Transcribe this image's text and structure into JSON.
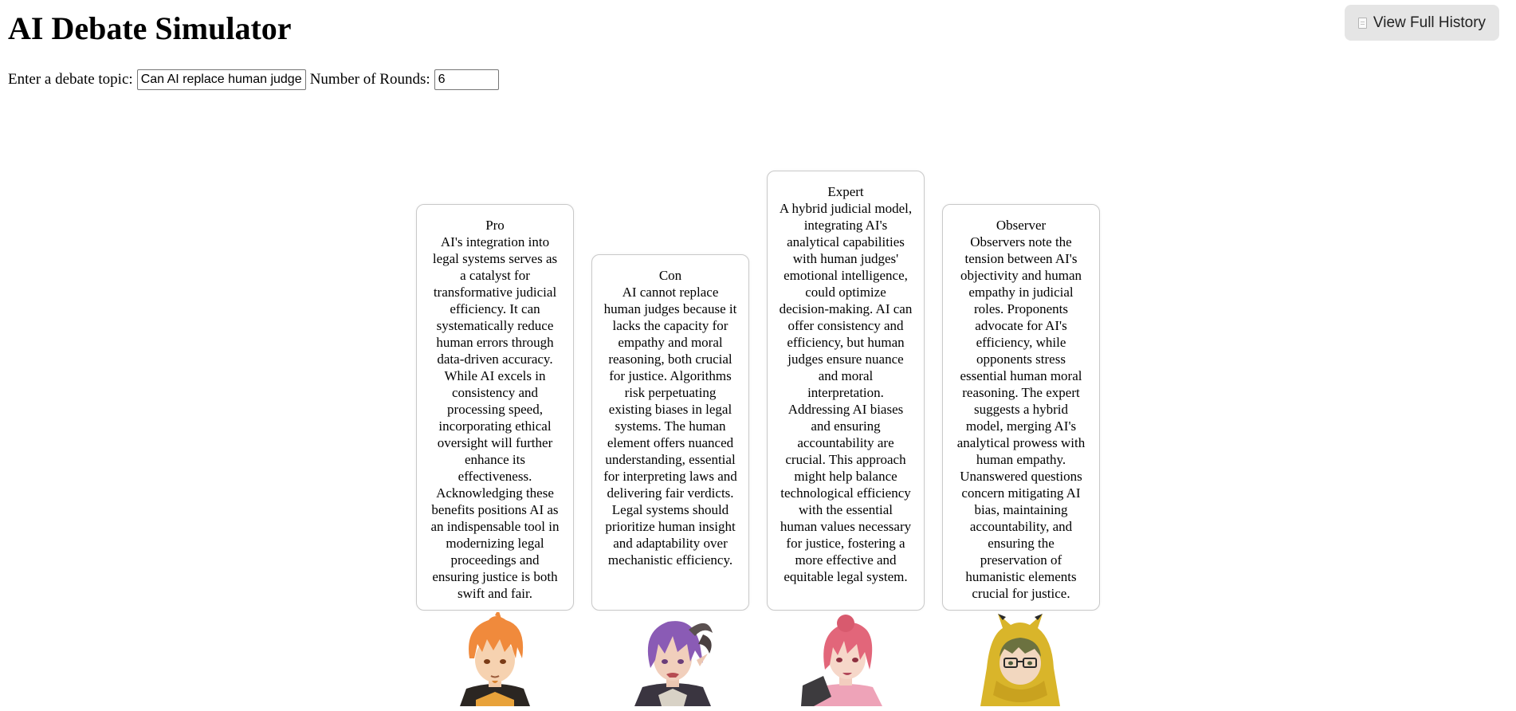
{
  "app": {
    "title": "AI Debate Simulator",
    "history_button_label": "View Full History",
    "history_icon": "document-icon"
  },
  "controls": {
    "topic_label": "Enter a debate topic:",
    "topic_value": "Can AI replace human judges?",
    "rounds_label": "Number of Rounds:",
    "rounds_value": "6"
  },
  "participants": [
    {
      "role": "Pro",
      "avatar": "orange-haired-boy-avatar",
      "text": "AI's integration into legal systems serves as a catalyst for transformative judicial efficiency. It can systematically reduce human errors through data-driven accuracy. While AI excels in consistency and processing speed, incorporating ethical oversight will further enhance its effectiveness. Acknowledging these benefits positions AI as an indispensable tool in modernizing legal proceedings and ensuring justice is both swift and fair."
    },
    {
      "role": "Con",
      "avatar": "purple-haired-horned-avatar",
      "text": "AI cannot replace human judges because it lacks the capacity for empathy and moral reasoning, both crucial for justice. Algorithms risk perpetuating existing biases in legal systems. The human element offers nuanced understanding, essential for interpreting laws and delivering fair verdicts. Legal systems should prioritize human insight and adaptability over mechanistic efficiency."
    },
    {
      "role": "Expert",
      "avatar": "pink-haired-girl-avatar",
      "text": "A hybrid judicial model, integrating AI's analytical capabilities with human judges' emotional intelligence, could optimize decision-making. AI can offer consistency and efficiency, but human judges ensure nuance and moral interpretation. Addressing AI biases and ensuring accountability are crucial. This approach might help balance technological efficiency with the essential human values necessary for justice, fostering a more effective and equitable legal system."
    },
    {
      "role": "Observer",
      "avatar": "yellow-hood-glasses-avatar",
      "text": "Observers note the tension between AI's objectivity and human empathy in judicial roles. Proponents advocate for AI's efficiency, while opponents stress essential human moral reasoning. The expert suggests a hybrid model, merging AI's analytical prowess with human empathy. Unanswered questions concern mitigating AI bias, maintaining accountability, and ensuring the preservation of humanistic elements crucial for justice."
    }
  ],
  "colors": {
    "button_bg": "#e5e5e5",
    "bubble_border": "#c9c9c9",
    "pro_hair": "#f08a3c",
    "con_hair": "#8a5bb5",
    "expert_hair": "#e2667a",
    "observer_hood": "#d9b52a"
  }
}
